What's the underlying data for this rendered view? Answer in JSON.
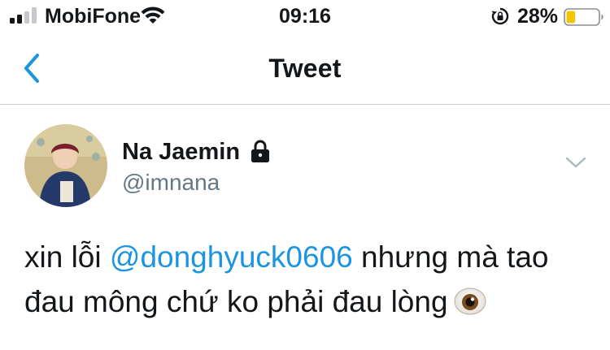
{
  "status_bar": {
    "carrier": "MobiFone",
    "time": "09:16",
    "battery_percent": "28%",
    "battery_level": 0.28,
    "signal_bars_filled": 2,
    "signal_bars_total": 4,
    "icons": [
      "signal-bars-icon",
      "wifi-icon",
      "rotation-lock-icon",
      "battery-icon"
    ]
  },
  "nav": {
    "title": "Tweet",
    "back_icon": "chevron-left-icon"
  },
  "tweet": {
    "display_name": "Na Jaemin",
    "handle": "@imnana",
    "protected_icon": "lock-icon",
    "menu_icon": "chevron-down-icon",
    "text_before": "xin lỗi ",
    "mention": "@donghyuck0606",
    "text_after": " nhưng mà tao đau mông chứ ko phải đau lòng",
    "emoji": "eye-emoji"
  },
  "colors": {
    "accent": "#1b95e0",
    "secondary_text": "#657786",
    "primary_text": "#14171a",
    "battery_fill": "#f5c400",
    "divider": "#c8ccd0"
  }
}
